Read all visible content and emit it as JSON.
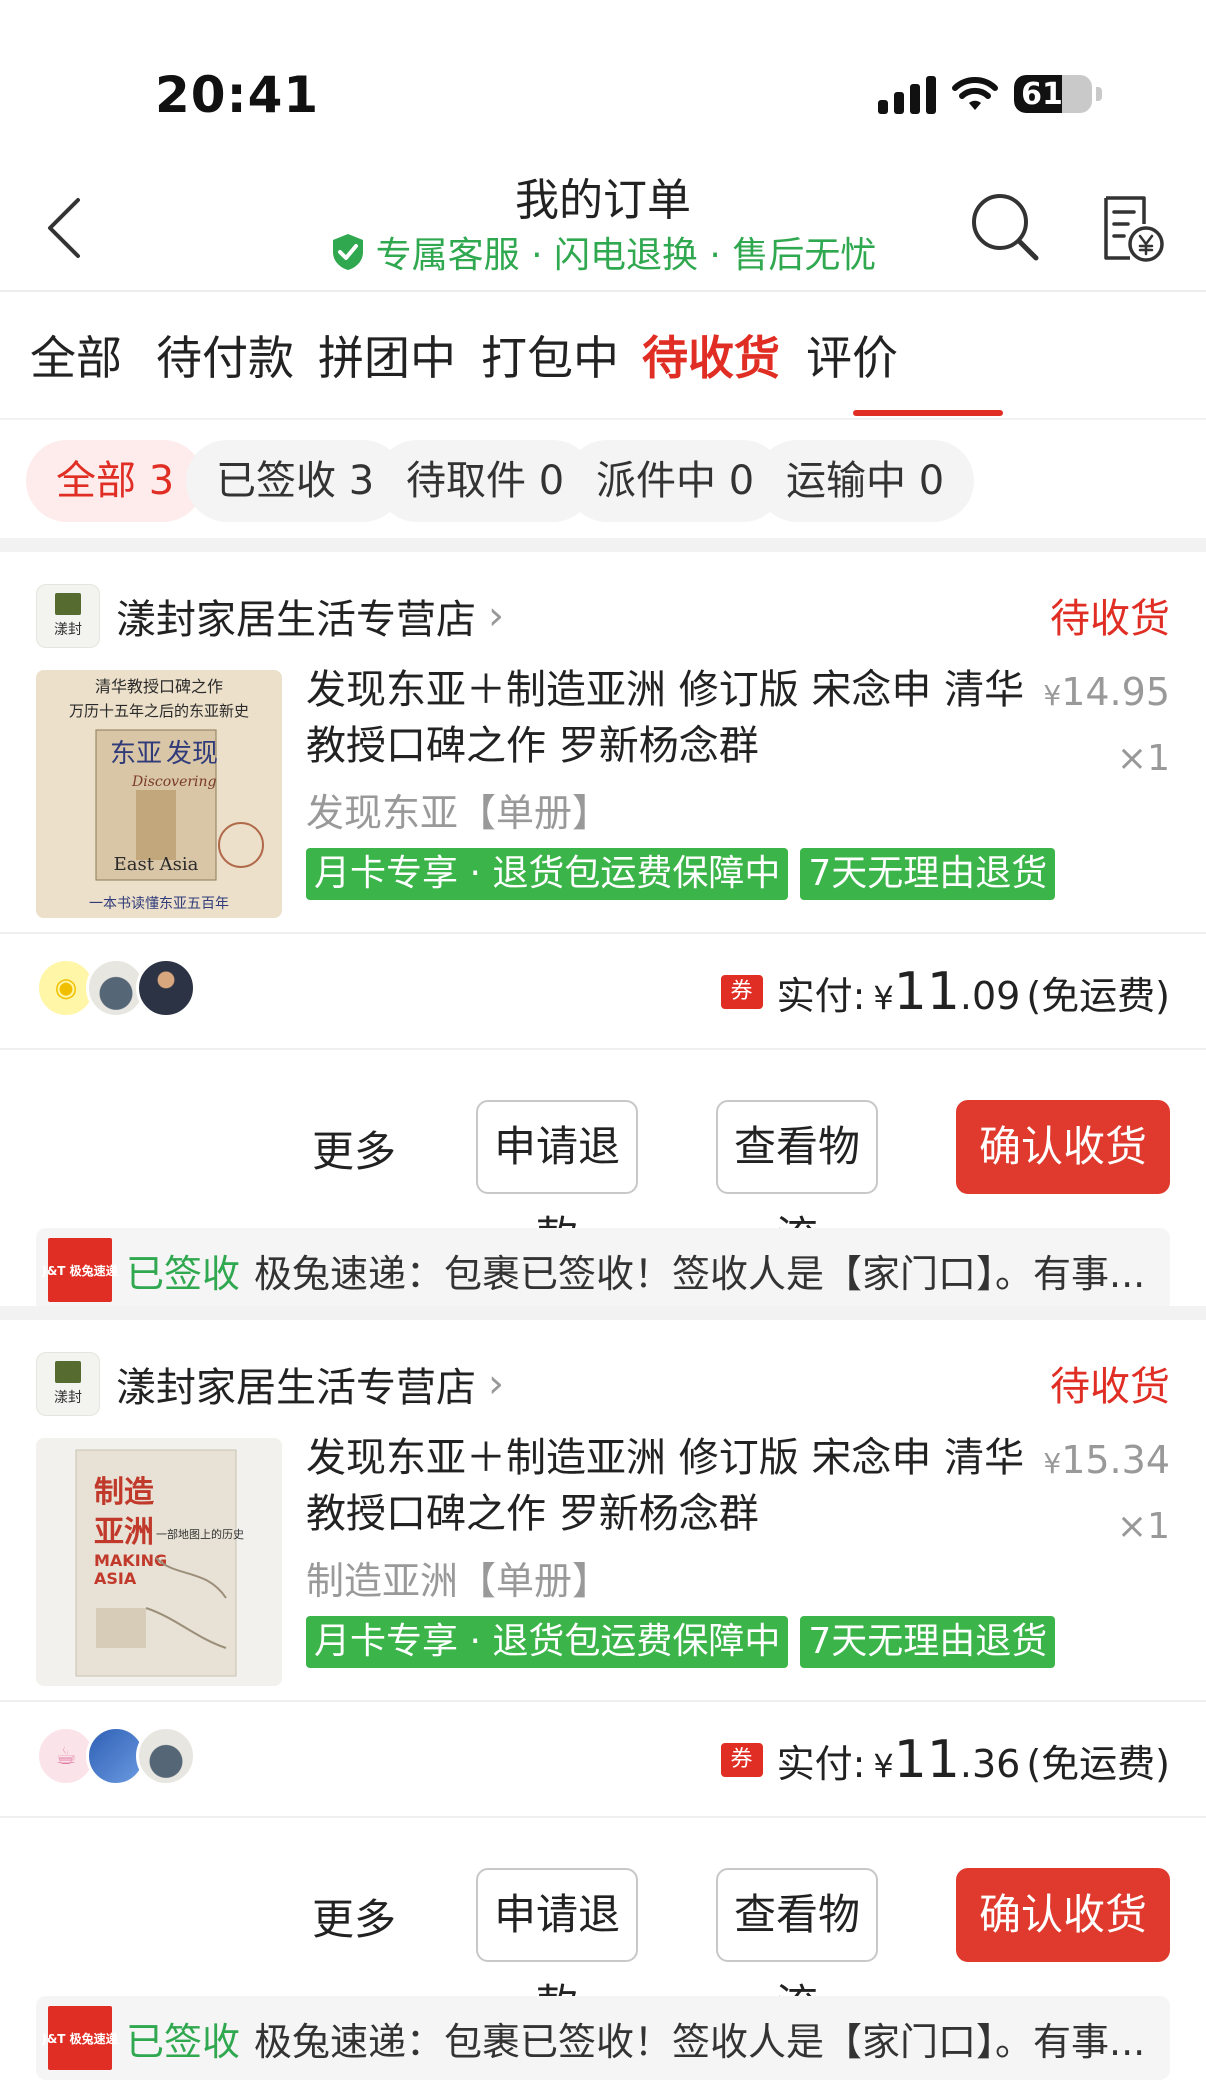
{
  "status_bar": {
    "time": "20:41",
    "battery": "61",
    "battery_level": 0.61
  },
  "header": {
    "title": "我的订单",
    "subtitle": "专属客服 · 闪电退换 · 售后无忧"
  },
  "tabs": [
    "全部",
    "待付款",
    "拼团中",
    "打包中",
    "待收货",
    "评价"
  ],
  "active_tab": "待收货",
  "filters": [
    "全部 3",
    "已签收 3",
    "待取件 0",
    "派件中 0",
    "运输中 0"
  ],
  "orders": [
    {
      "shop_name": "漾封家居生活专营店",
      "shop_logo_text": "漾封",
      "status": "待收货",
      "cover_text": {
        "line1": "清华教授口碑之作",
        "line2": "万历十五年之后的东亚新史",
        "big1": "东亚",
        "big2": "发现",
        "en1": "Discovering",
        "en2": "East Asia",
        "footer": "一本书读懂东亚五百年"
      },
      "title": "发现东亚＋制造亚洲 修订版 宋念申 清华教授口碑之作 罗新杨念群",
      "variant": "发现东亚【单册】",
      "price_symbol": "¥",
      "price": "14.95",
      "qty": "×1",
      "tags": [
        "月卡专享 · 退货包运费保障中",
        "7天无理由退货"
      ],
      "coupon_label": "券",
      "pay_label": "实付:",
      "pay_symbol": "¥",
      "pay_int": "11",
      "pay_dec": ".09",
      "pay_note": "(免运费)",
      "more": "更多",
      "btn_refund": "申请退款",
      "btn_logistics": "查看物流",
      "btn_confirm": "确认收货",
      "courier_logo": "J&T 极兔速递",
      "log_status": "已签收",
      "log_text": "极兔速递：包裹已签收！签收人是【家门口】。有事..."
    },
    {
      "shop_name": "漾封家居生活专营店",
      "shop_logo_text": "漾封",
      "status": "待收货",
      "cover_text": {
        "big1": "制造",
        "big2": "亚洲",
        "en1": "MAKING",
        "en2": "ASIA",
        "line1": "一部地图上的历史"
      },
      "title": "发现东亚＋制造亚洲 修订版 宋念申 清华教授口碑之作 罗新杨念群",
      "variant": "制造亚洲【单册】",
      "price_symbol": "¥",
      "price": "15.34",
      "qty": "×1",
      "tags": [
        "月卡专享 · 退货包运费保障中",
        "7天无理由退货"
      ],
      "coupon_label": "券",
      "pay_label": "实付:",
      "pay_symbol": "¥",
      "pay_int": "11",
      "pay_dec": ".36",
      "pay_note": "(免运费)",
      "more": "更多",
      "btn_refund": "申请退款",
      "btn_logistics": "查看物流",
      "btn_confirm": "确认收货",
      "courier_logo": "J&T 极兔速递",
      "log_status": "已签收",
      "log_text": "极兔速递：包裹已签收！签收人是【家门口】。有事..."
    }
  ],
  "colors": {
    "accent": "#e02e24",
    "green": "#2fa84f",
    "tag_green": "#3bb54a"
  }
}
